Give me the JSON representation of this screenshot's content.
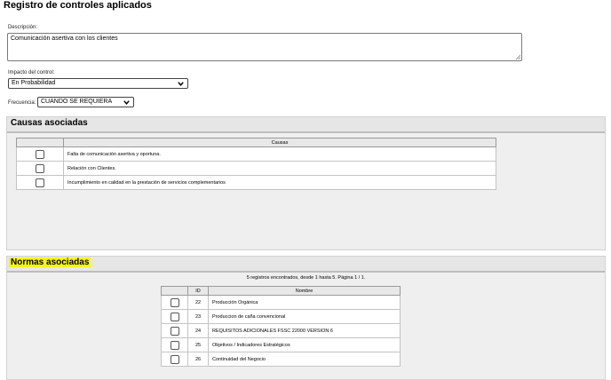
{
  "page": {
    "title": "Registro de controles aplicados"
  },
  "form": {
    "description_label": "Descripción:",
    "description_value": "Comunicación asertiva con los clientes",
    "impact_label": "Impacto del control:",
    "impact_value": "En Probabilidad",
    "frequency_label": "Frecuencia:",
    "frequency_value": "CUANDO SE REQUIERA"
  },
  "causas": {
    "title": "Causas asociadas",
    "column_header": "Causas",
    "rows": [
      {
        "text": "Falta de comunicación asertiva y oportuna.",
        "checked": false
      },
      {
        "text": "Relación con Clientes.",
        "checked": false
      },
      {
        "text": "Incumplimiento en calidad en la prestación de servicios complementarios",
        "checked": false
      }
    ]
  },
  "normas": {
    "title": "Normas asociadas",
    "summary": "5 registros encontrados, desde 1 hasta 5. Página 1 / 1.",
    "headers": {
      "id": "ID",
      "name": "Nombre"
    },
    "rows": [
      {
        "id": "22",
        "name": "Producción Orgánica",
        "checked": false
      },
      {
        "id": "23",
        "name": "Produccion de caña convencional",
        "checked": false
      },
      {
        "id": "24",
        "name": "REQUISITOS ADICIONALES FSSC 22000 VERSION 6",
        "checked": false
      },
      {
        "id": "25",
        "name": "Objetivos / Indicadores Estratégicos",
        "checked": false
      },
      {
        "id": "26",
        "name": "Continuidad del Negocio",
        "checked": false
      }
    ]
  },
  "colors": {
    "highlight": "#f5f516",
    "section_bg": "#efefef"
  }
}
